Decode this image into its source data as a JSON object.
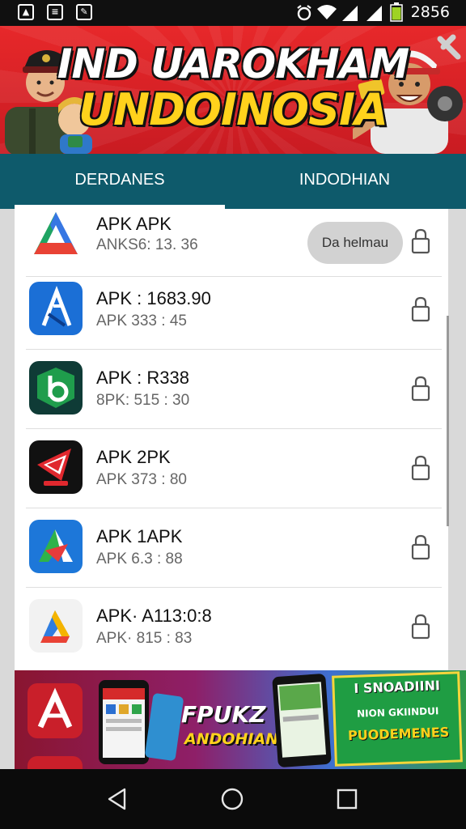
{
  "status_bar": {
    "time": "2856"
  },
  "banner": {
    "title_line1": "IND UAROKHAM",
    "title_line2": "UNDOINOSIA"
  },
  "tabs": [
    {
      "label": "DERDANES",
      "selected": true
    },
    {
      "label": "INDODHIAN",
      "selected": false
    }
  ],
  "apps": [
    {
      "title": "APK APK",
      "subtitle": "ANKS6: 13. 36",
      "icon": "drive-triangle-icon",
      "action_label": "Da helmau"
    },
    {
      "title": "APK : 1683.90",
      "subtitle": "APK 333 : 45",
      "icon": "blue-a-logo-icon"
    },
    {
      "title": "APK : R338",
      "subtitle": "8PK: 515 : 30",
      "icon": "green-b-logo-icon"
    },
    {
      "title": "APK 2PK",
      "subtitle": "APK 373 : 80",
      "icon": "red-card-logo-icon"
    },
    {
      "title": "APK 1APK",
      "subtitle": "APK 6.3 : 88",
      "icon": "colorful-a-logo-icon"
    },
    {
      "title": "APK· A113:0:8",
      "subtitle": "APK· 815 : 83",
      "icon": "drive-triangle-light-icon"
    }
  ],
  "ad": {
    "headline": "FPUKZ",
    "subheadline": "ANDOHIAN",
    "tag_line1": "I SNOADIINI",
    "tag_line2": "NION GKIINDUI",
    "tag_line3": "PUODEMENES"
  }
}
